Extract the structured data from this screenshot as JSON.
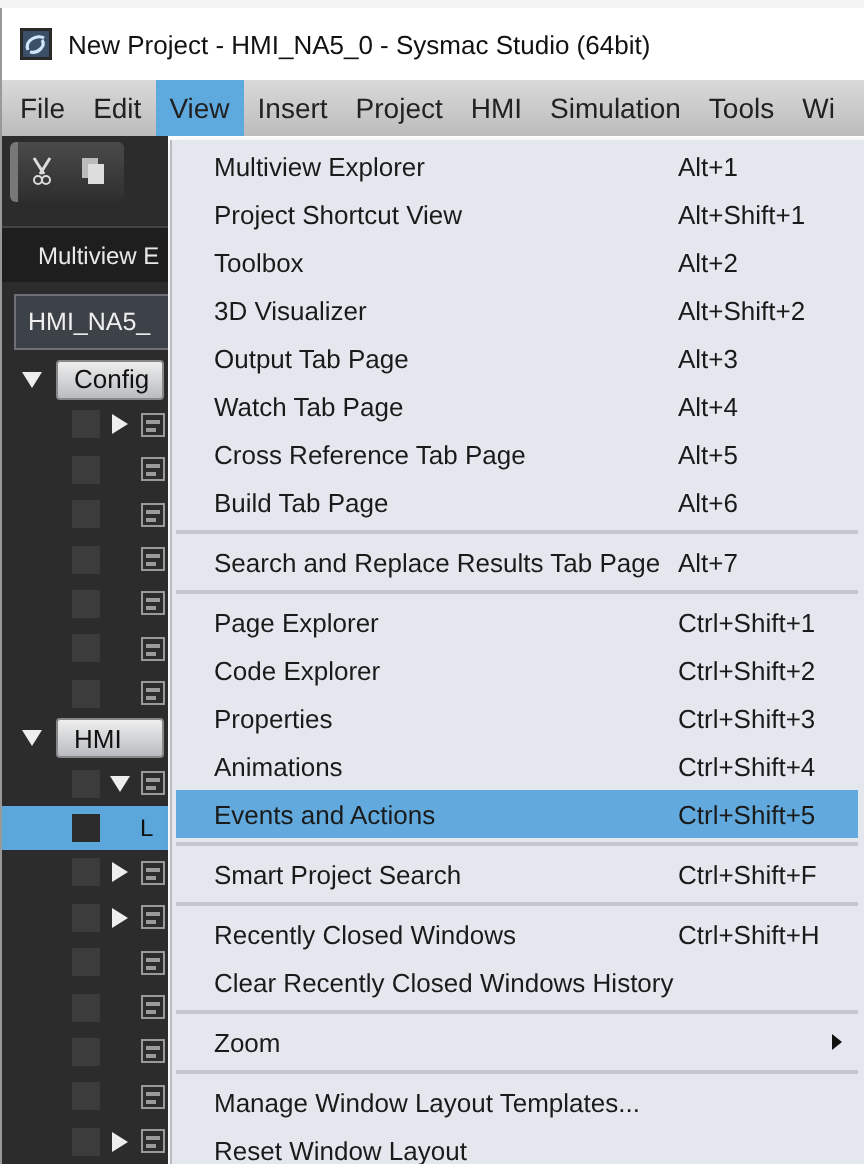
{
  "window": {
    "title": "New Project - HMI_NA5_0 - Sysmac Studio (64bit)"
  },
  "menubar": [
    {
      "label": "File",
      "selected": false
    },
    {
      "label": "Edit",
      "selected": false
    },
    {
      "label": "View",
      "selected": true
    },
    {
      "label": "Insert",
      "selected": false
    },
    {
      "label": "Project",
      "selected": false
    },
    {
      "label": "HMI",
      "selected": false
    },
    {
      "label": "Simulation",
      "selected": false
    },
    {
      "label": "Tools",
      "selected": false
    },
    {
      "label": "Wi",
      "selected": false
    }
  ],
  "multiview": {
    "title": "Multiview E",
    "device": "HMI_NA5_",
    "groups": [
      {
        "label": "Config",
        "expanded": true,
        "items": [
          {
            "kind": "branch",
            "expanded": false,
            "selected": false
          },
          {
            "kind": "leaf",
            "selected": false
          },
          {
            "kind": "leaf",
            "selected": false
          },
          {
            "kind": "leaf",
            "selected": false
          },
          {
            "kind": "leaf",
            "selected": false
          },
          {
            "kind": "leaf",
            "selected": false
          },
          {
            "kind": "leaf",
            "selected": false
          }
        ]
      },
      {
        "label": "HMI",
        "expanded": true,
        "items": [
          {
            "kind": "branch",
            "expanded": true,
            "selected": false,
            "children": [
              {
                "kind": "leaf",
                "label": "L",
                "selected": true
              }
            ]
          },
          {
            "kind": "branch",
            "expanded": false,
            "selected": false
          },
          {
            "kind": "branch",
            "expanded": false,
            "selected": false
          },
          {
            "kind": "leaf",
            "selected": false
          },
          {
            "kind": "leaf",
            "selected": false
          },
          {
            "kind": "leaf",
            "selected": false
          },
          {
            "kind": "leaf",
            "selected": false
          },
          {
            "kind": "branch",
            "expanded": false,
            "selected": false
          }
        ]
      }
    ]
  },
  "view_menu": {
    "items": [
      {
        "kind": "item",
        "label": "Multiview Explorer",
        "shortcut": "Alt+1",
        "selected": false
      },
      {
        "kind": "item",
        "label": "Project Shortcut View",
        "shortcut": "Alt+Shift+1",
        "selected": false
      },
      {
        "kind": "item",
        "label": "Toolbox",
        "shortcut": "Alt+2",
        "selected": false
      },
      {
        "kind": "item",
        "label": "3D Visualizer",
        "shortcut": "Alt+Shift+2",
        "selected": false
      },
      {
        "kind": "item",
        "label": "Output Tab Page",
        "shortcut": "Alt+3",
        "selected": false
      },
      {
        "kind": "item",
        "label": "Watch Tab Page",
        "shortcut": "Alt+4",
        "selected": false
      },
      {
        "kind": "item",
        "label": "Cross Reference Tab Page",
        "shortcut": "Alt+5",
        "selected": false
      },
      {
        "kind": "item",
        "label": "Build Tab Page",
        "shortcut": "Alt+6",
        "selected": false
      },
      {
        "kind": "separator"
      },
      {
        "kind": "item",
        "label": "Search and Replace Results Tab Page",
        "shortcut": "Alt+7",
        "selected": false
      },
      {
        "kind": "separator"
      },
      {
        "kind": "item",
        "label": "Page Explorer",
        "shortcut": "Ctrl+Shift+1",
        "selected": false
      },
      {
        "kind": "item",
        "label": "Code Explorer",
        "shortcut": "Ctrl+Shift+2",
        "selected": false
      },
      {
        "kind": "item",
        "label": "Properties",
        "shortcut": "Ctrl+Shift+3",
        "selected": false
      },
      {
        "kind": "item",
        "label": "Animations",
        "shortcut": "Ctrl+Shift+4",
        "selected": false
      },
      {
        "kind": "item",
        "label": "Events and Actions",
        "shortcut": "Ctrl+Shift+5",
        "selected": true
      },
      {
        "kind": "separator"
      },
      {
        "kind": "item",
        "label": "Smart Project Search",
        "shortcut": "Ctrl+Shift+F",
        "selected": false
      },
      {
        "kind": "separator"
      },
      {
        "kind": "item",
        "label": "Recently Closed Windows",
        "shortcut": "Ctrl+Shift+H",
        "selected": false
      },
      {
        "kind": "item",
        "label": "Clear Recently Closed Windows History",
        "selected": false
      },
      {
        "kind": "separator"
      },
      {
        "kind": "submenu",
        "label": "Zoom",
        "selected": false
      },
      {
        "kind": "separator"
      },
      {
        "kind": "item",
        "label": "Manage Window Layout Templates...",
        "selected": false
      },
      {
        "kind": "item",
        "label": "Reset Window Layout",
        "selected": false
      }
    ]
  }
}
